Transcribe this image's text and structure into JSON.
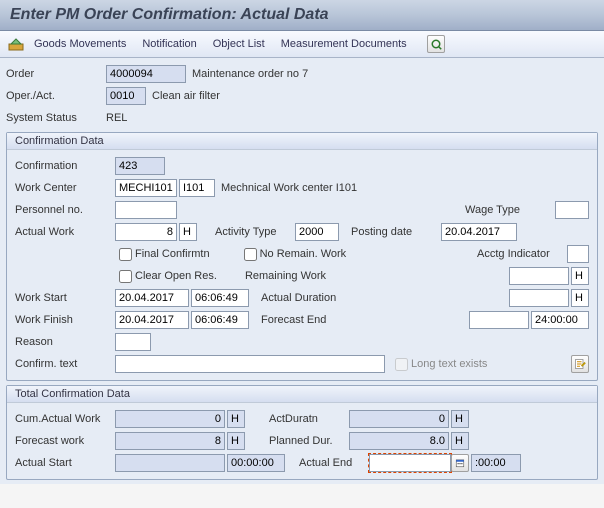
{
  "title": "Enter PM Order Confirmation: Actual Data",
  "toolbar": {
    "goods_movements": "Goods Movements",
    "notification": "Notification",
    "object_list": "Object List",
    "measurement_docs": "Measurement Documents"
  },
  "header": {
    "order_label": "Order",
    "order_value": "4000094",
    "order_desc": "Maintenance order no 7",
    "oper_label": "Oper./Act.",
    "oper_value": "0010",
    "oper_desc": "Clean air filter",
    "status_label": "System Status",
    "status_value": "REL"
  },
  "conf": {
    "panel_title": "Confirmation Data",
    "confirmation_label": "Confirmation",
    "confirmation_value": "423",
    "work_center_label": "Work Center",
    "work_center_value": "MECHI101",
    "work_center_plant": "I101",
    "work_center_desc": "Mechnical Work center I101",
    "personnel_label": "Personnel no.",
    "personnel_value": "",
    "wage_type_label": "Wage Type",
    "wage_type_value": "",
    "actual_work_label": "Actual Work",
    "actual_work_value": "8",
    "actual_work_unit": "H",
    "activity_type_label": "Activity Type",
    "activity_type_value": "2000",
    "posting_date_label": "Posting date",
    "posting_date_value": "20.04.2017",
    "final_confirm_label": "Final Confirmtn",
    "no_remain_label": "No Remain. Work",
    "acctg_label": "Acctg Indicator",
    "acctg_value": "",
    "clear_open_label": "Clear Open Res.",
    "remaining_work_label": "Remaining Work",
    "remaining_work_value": "",
    "remaining_work_unit": "H",
    "work_start_label": "Work Start",
    "work_start_date": "20.04.2017",
    "work_start_time": "06:06:49",
    "actual_duration_label": "Actual Duration",
    "actual_duration_value": "",
    "actual_duration_unit": "H",
    "work_finish_label": "Work Finish",
    "work_finish_date": "20.04.2017",
    "work_finish_time": "06:06:49",
    "forecast_end_label": "Forecast End",
    "forecast_end_date": "",
    "forecast_end_time": "24:00:00",
    "reason_label": "Reason",
    "reason_value": "",
    "confirm_text_label": "Confirm. text",
    "confirm_text_value": "",
    "long_text_label": "Long text exists"
  },
  "total": {
    "panel_title": "Total Confirmation Data",
    "cum_work_label": "Cum.Actual Work",
    "cum_work_value": "0",
    "cum_work_unit": "H",
    "act_dur_label": "ActDuratn",
    "act_dur_value": "0",
    "act_dur_unit": "H",
    "forecast_work_label": "Forecast work",
    "forecast_work_value": "8",
    "forecast_work_unit": "H",
    "planned_dur_label": "Planned Dur.",
    "planned_dur_value": "8.0",
    "planned_dur_unit": "H",
    "actual_start_label": "Actual Start",
    "actual_start_date": "",
    "actual_start_time": "00:00:00",
    "actual_end_label": "Actual End",
    "actual_end_date": "",
    "actual_end_time": ":00:00"
  }
}
